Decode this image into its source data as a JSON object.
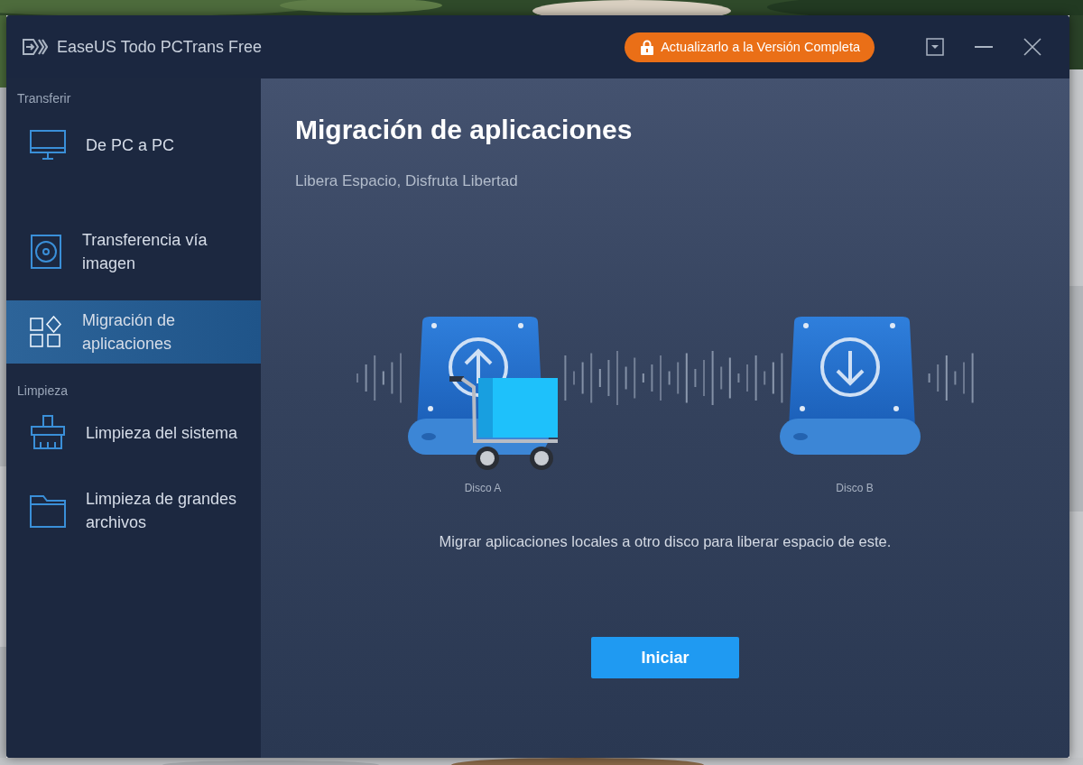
{
  "window": {
    "title": "EaseUS Todo PCTrans Free",
    "upgrade_button": "Actualizarlo a la Versión Completa"
  },
  "sidebar": {
    "groups": [
      {
        "label": "Transferir",
        "items": [
          {
            "label": "De PC a PC",
            "selected": false
          },
          {
            "label": "Transferencia vía imagen",
            "selected": false
          },
          {
            "label": "Migración de aplicaciones",
            "selected": true
          }
        ]
      },
      {
        "label": "Limpieza",
        "items": [
          {
            "label": "Limpieza del sistema",
            "selected": false
          },
          {
            "label": "Limpieza de grandes archivos",
            "selected": false
          }
        ]
      }
    ]
  },
  "main": {
    "title": "Migración de aplicaciones",
    "subtitle": "Libera Espacio, Disfruta Libertad",
    "disks": [
      {
        "label": "Disco A"
      },
      {
        "label": "Disco B"
      }
    ],
    "description": "Migrar aplicaciones locales a otro disco para liberar espacio de este.",
    "start_button": "Iniciar"
  }
}
